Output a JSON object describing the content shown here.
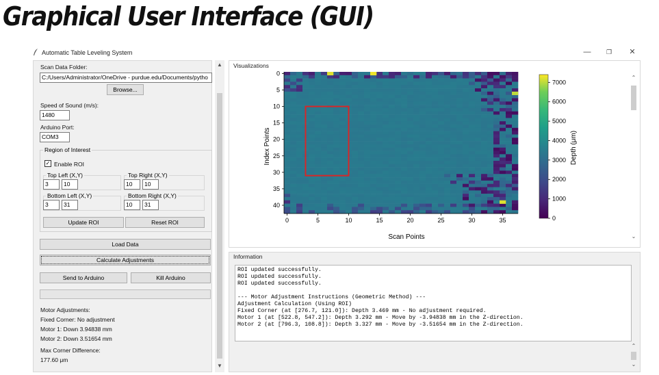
{
  "slide_title": "Graphical User Interface (GUI)",
  "window": {
    "title": "Automatic Table Leveling System",
    "controls": {
      "minimize": "—",
      "maximize": "❐",
      "close": "✕"
    }
  },
  "left_panel": {
    "scan_folder_label": "Scan Data Folder:",
    "scan_folder_value": "C:/Users/Administrator/OneDrive - purdue.edu/Documents/pytho",
    "browse_button": "Browse...",
    "speed_label": "Speed of Sound (m/s):",
    "speed_value": "1480",
    "port_label": "Arduino Port:",
    "port_value": "COM3",
    "roi": {
      "title": "Region of Interest",
      "enable_label": "Enable ROI",
      "enabled": true,
      "top_left": {
        "label": "Top Left (X,Y)",
        "x": "3",
        "y": "10"
      },
      "top_right": {
        "label": "Top Right (X,Y)",
        "x": "10",
        "y": "10"
      },
      "bottom_left": {
        "label": "Bottom Left (X,Y)",
        "x": "3",
        "y": "31"
      },
      "bottom_right": {
        "label": "Bottom Right (X,Y)",
        "x": "10",
        "y": "31"
      },
      "update_button": "Update ROI",
      "reset_button": "Reset ROI"
    },
    "load_button": "Load Data",
    "calculate_button": "Calculate Adjustments",
    "send_button": "Send to Arduino",
    "kill_button": "Kill Arduino",
    "progress_fraction": 0,
    "motor_heading": "Motor Adjustments:",
    "fixed_corner": "Fixed Corner: No adjustment",
    "motor1": "Motor 1: Down 3.94838 mm",
    "motor2": "Motor 2: Down 3.51654 mm",
    "max_diff_label": "Max Corner Difference:",
    "max_diff_value": "177.60 μm"
  },
  "visualizations": {
    "title": "Visualizations"
  },
  "information": {
    "title": "Information",
    "lines": [
      "ROI updated successfully.",
      "ROI updated successfully.",
      "ROI updated successfully.",
      "",
      "--- Motor Adjustment Instructions (Geometric Method) ---",
      "Adjustment Calculation (Using ROI)",
      "Fixed Corner (at [276.7, 121.0]): Depth 3.469 mm - No adjustment required.",
      "Motor 1 (at [522.8, 547.2]): Depth 3.292 mm - Move by -3.94838 mm in the Z-direction.",
      "Motor 2 (at [796.3, 108.8]): Depth 3.327 mm - Move by -3.51654 mm in the Z-direction."
    ]
  },
  "chart_data": {
    "type": "heatmap",
    "xlabel": "Scan Points",
    "ylabel": "Index Points",
    "xlim": [
      -0.5,
      37.5
    ],
    "ylim": [
      42.5,
      -0.5
    ],
    "xticks": [
      "0",
      "5",
      "10",
      "15",
      "20",
      "25",
      "30",
      "35"
    ],
    "yticks": [
      "0",
      "5",
      "10",
      "15",
      "20",
      "25",
      "30",
      "35",
      "40"
    ],
    "colorbar": {
      "label": "Depth (μm)",
      "min": 0,
      "max": 7400,
      "ticks": [
        "0",
        "1000",
        "2000",
        "3000",
        "4000",
        "5000",
        "6000",
        "7000"
      ],
      "colormap": "viridis"
    },
    "dominant_value_um": 3400,
    "roi_rectangle": {
      "x1": 3,
      "y1": 10,
      "x2": 10,
      "y2": 31,
      "color": "#d62728"
    },
    "outliers": [
      {
        "x": 7,
        "y": 0,
        "value": 7200
      },
      {
        "x": 14,
        "y": 0,
        "value": 7300
      },
      {
        "x": 37,
        "y": 6,
        "value": 7000
      },
      {
        "x": 35,
        "y": 39,
        "value": 7200
      }
    ]
  }
}
